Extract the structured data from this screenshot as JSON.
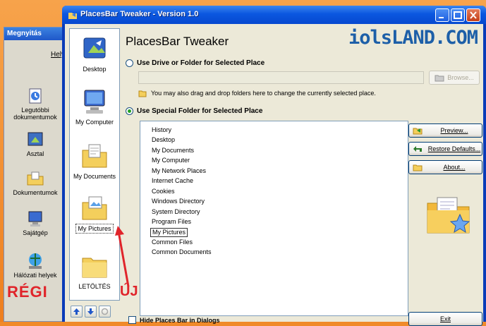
{
  "old_dialog": {
    "title": "Megnyitás",
    "helye": "Hely:",
    "items": [
      {
        "label": "Legutóbbi dokumentumok",
        "icon": "recent-docs-icon"
      },
      {
        "label": "Asztal",
        "icon": "desktop-icon"
      },
      {
        "label": "Dokumentumok",
        "icon": "documents-folder-icon"
      },
      {
        "label": "Sajátgép",
        "icon": "computer-icon"
      },
      {
        "label": "Hálózati helyek",
        "icon": "network-places-icon"
      }
    ],
    "caption": "RÉGI"
  },
  "window": {
    "title": "PlacesBar Tweaker - Version 1.0",
    "heading": "PlacesBar Tweaker",
    "brand": "iolsLAND.COM"
  },
  "places_bar": {
    "items": [
      {
        "label": "Desktop",
        "icon": "desktop-icon"
      },
      {
        "label": "My Computer",
        "icon": "computer-icon"
      },
      {
        "label": "My Documents",
        "icon": "documents-folder-icon"
      },
      {
        "label": "My Pictures",
        "icon": "pictures-folder-icon",
        "selected": true
      },
      {
        "label": "LETÖLTÉS",
        "icon": "folder-icon"
      }
    ]
  },
  "drive_option": {
    "label": "Use Drive or Folder for Selected Place",
    "browse_label": "Browse...",
    "hint": "You may also drag and drop folders here to change the currently selected place."
  },
  "special_option": {
    "label": "Use Special Folder for Selected Place",
    "folders": [
      "History",
      "Desktop",
      "My Documents",
      "My Computer",
      "My Network Places",
      "Internet Cache",
      "Cookies",
      "Windows Directory",
      "System Directory",
      "Program Files",
      "My Pictures",
      "Common Files",
      "Common Documents"
    ],
    "selected": "My Pictures"
  },
  "buttons": {
    "preview": "Preview...",
    "restore": "Restore Defaults...",
    "about": "About...",
    "exit": "Exit"
  },
  "hide_label": "Hide Places Bar in Dialogs",
  "new_caption": "ÚJ"
}
